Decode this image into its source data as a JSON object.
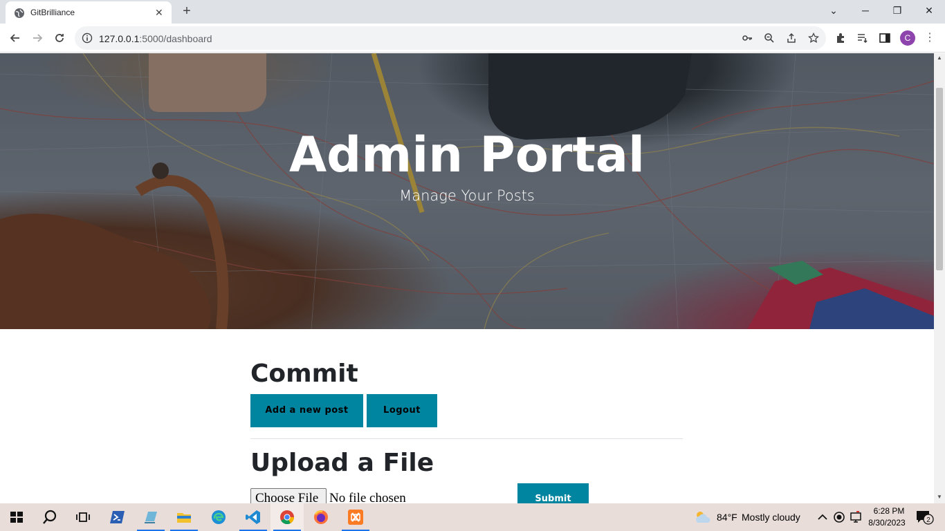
{
  "browser": {
    "tab_title": "GitBrilliance",
    "url_host": "127.0.0.1",
    "url_path": ":5000/dashboard",
    "profile_initial": "C"
  },
  "hero": {
    "title": "Admin Portal",
    "subtitle": "Manage Your Posts"
  },
  "main": {
    "commit_heading": "Commit",
    "add_post_label": "Add a new post",
    "logout_label": "Logout",
    "upload_heading": "Upload a File",
    "choose_file_label": "Choose File",
    "no_file_text": "No file chosen",
    "submit_label": "Submit"
  },
  "taskbar": {
    "weather_temp": "84°F",
    "weather_desc": "Mostly cloudy",
    "time": "6:28 PM",
    "date": "8/30/2023",
    "notification_count": "2"
  },
  "colors": {
    "accent": "#0085a1",
    "heading": "#212529"
  }
}
